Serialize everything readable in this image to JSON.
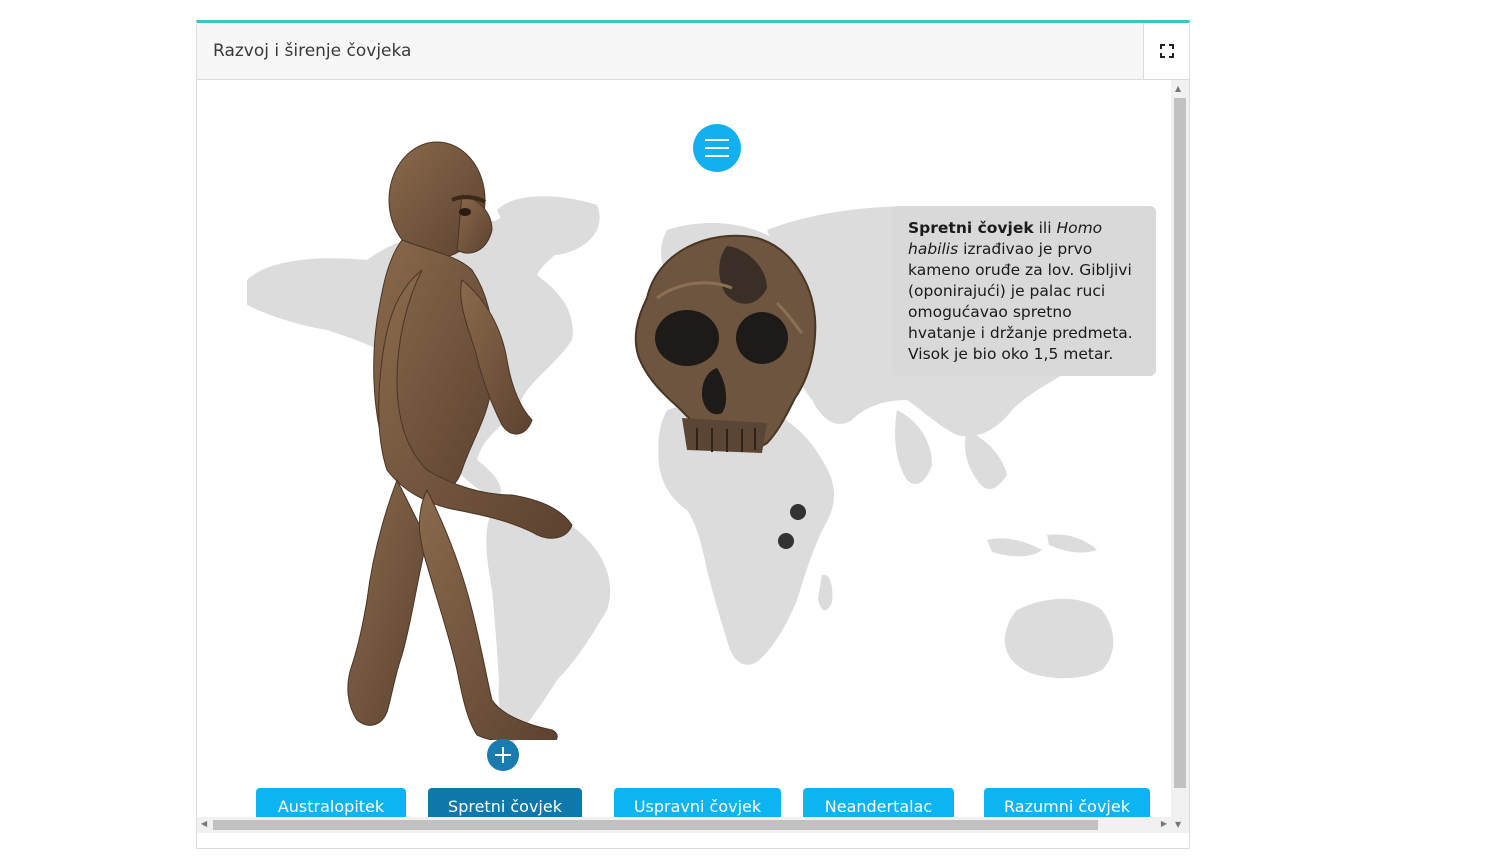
{
  "header": {
    "title": "Razvoj i širenje čovjeka"
  },
  "info": {
    "name_bold": "Spretni čovjek",
    "connector": " ili ",
    "latin_italic": "Homo habilis",
    "description": " izrađivao je prvo kameno oruđe za lov. Gibljivi (oponirajući) je palac ruci omogućavao spretno hvatanje i držanje predmeta. Visok je bio oko 1,5 metar."
  },
  "era_buttons": [
    {
      "label": "Australopitek",
      "active": false
    },
    {
      "label": "Spretni čovjek",
      "active": true
    },
    {
      "label": "Uspravni čovjek",
      "active": false
    },
    {
      "label": "Neandertalac",
      "active": false
    },
    {
      "label": "Razumni čovjek",
      "active": false
    }
  ],
  "icons": {
    "fullscreen": "fullscreen-icon",
    "menu": "hamburger-menu-icon",
    "plus": "plus-icon"
  },
  "colors": {
    "accent_top_border": "#3cc6c0",
    "button": "#0db4f2",
    "button_active": "#0f78aa",
    "menu_button": "#12b0ef",
    "map": "#dcdcdc"
  }
}
